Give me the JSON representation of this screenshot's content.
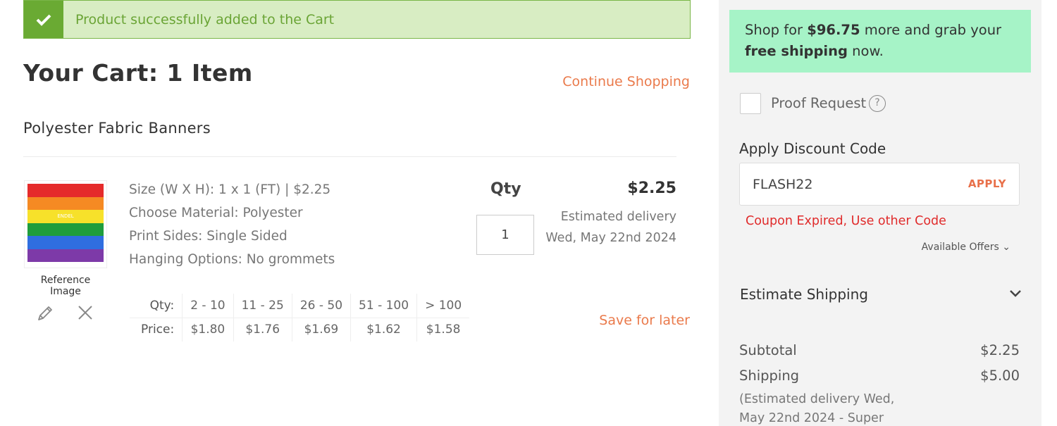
{
  "banner": {
    "message": "Product successfully added to the Cart",
    "icon": "check-icon"
  },
  "cart": {
    "title": "Your Cart: 1 Item",
    "continue_label": "Continue Shopping"
  },
  "product": {
    "name": "Polyester Fabric Banners",
    "thumb_text": "ENDEL",
    "thumb_stripes": [
      "#e52b2b",
      "#f58a23",
      "#f7e12a",
      "#1f9d3c",
      "#2f6ee0",
      "#7d3aa8"
    ],
    "reference_caption": "Reference Image",
    "options": [
      "Size (W X H): 1 x 1 (FT) | $2.25",
      "Choose Material: Polyester",
      "Print Sides: Single Sided",
      "Hanging Options: No grommets"
    ],
    "qty_label": "Qty",
    "qty_value": "1",
    "price": "$2.25",
    "delivery_line1": "Estimated delivery",
    "delivery_line2": "Wed, May 22nd 2024",
    "save_later": "Save for later",
    "tiers": {
      "qty_header": "Qty:",
      "price_header": "Price:",
      "qty": [
        "2 - 10",
        "11 - 25",
        "26 - 50",
        "51 - 100",
        "> 100"
      ],
      "price": [
        "$1.80",
        "$1.76",
        "$1.69",
        "$1.62",
        "$1.58"
      ]
    }
  },
  "side": {
    "promo_pre": "Shop for ",
    "promo_amount": "$96.75",
    "promo_mid": " more and grab your",
    "promo_bold": "free shipping",
    "promo_post": " now.",
    "proof_label": "Proof Request",
    "help": "?",
    "discount_title": "Apply Discount Code",
    "discount_value": "FLASH22",
    "apply_label": "APPLY",
    "coupon_error": "Coupon Expired, Use other Code",
    "available_offers": "Available Offers ⌄",
    "estimate_shipping": "Estimate Shipping",
    "subtotal_label": "Subtotal",
    "subtotal_value": "$2.25",
    "shipping_label": "Shipping",
    "shipping_value": "$5.00",
    "shipping_note": "(Estimated delivery Wed, May 22nd 2024 - Super"
  },
  "colors": {
    "accent": "#ea7a4b",
    "success": "#6aaa33",
    "error": "#e02b2b",
    "promo_bg": "#a6f3c7"
  }
}
